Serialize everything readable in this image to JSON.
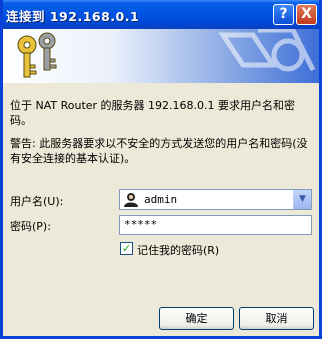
{
  "window": {
    "title": "连接到 192.168.0.1",
    "help_label": "?",
    "close_label": "X"
  },
  "message": {
    "line1": "位于 NAT Router 的服务器 192.168.0.1 要求用户名和密码。",
    "warning": "警告: 此服务器要求以不安全的方式发送您的用户名和密码(没有安全连接的基本认证)。"
  },
  "form": {
    "username_label": "用户名(U):",
    "username_value": "admin",
    "password_label": "密码(P):",
    "password_value": "*****",
    "remember_label": "记住我的密码(R)",
    "remember_checked": true
  },
  "buttons": {
    "ok": "确定",
    "cancel": "取消"
  },
  "icons": {
    "banner": "keys-icon",
    "user": "user-icon",
    "dropdown": "chevron-down-icon"
  }
}
